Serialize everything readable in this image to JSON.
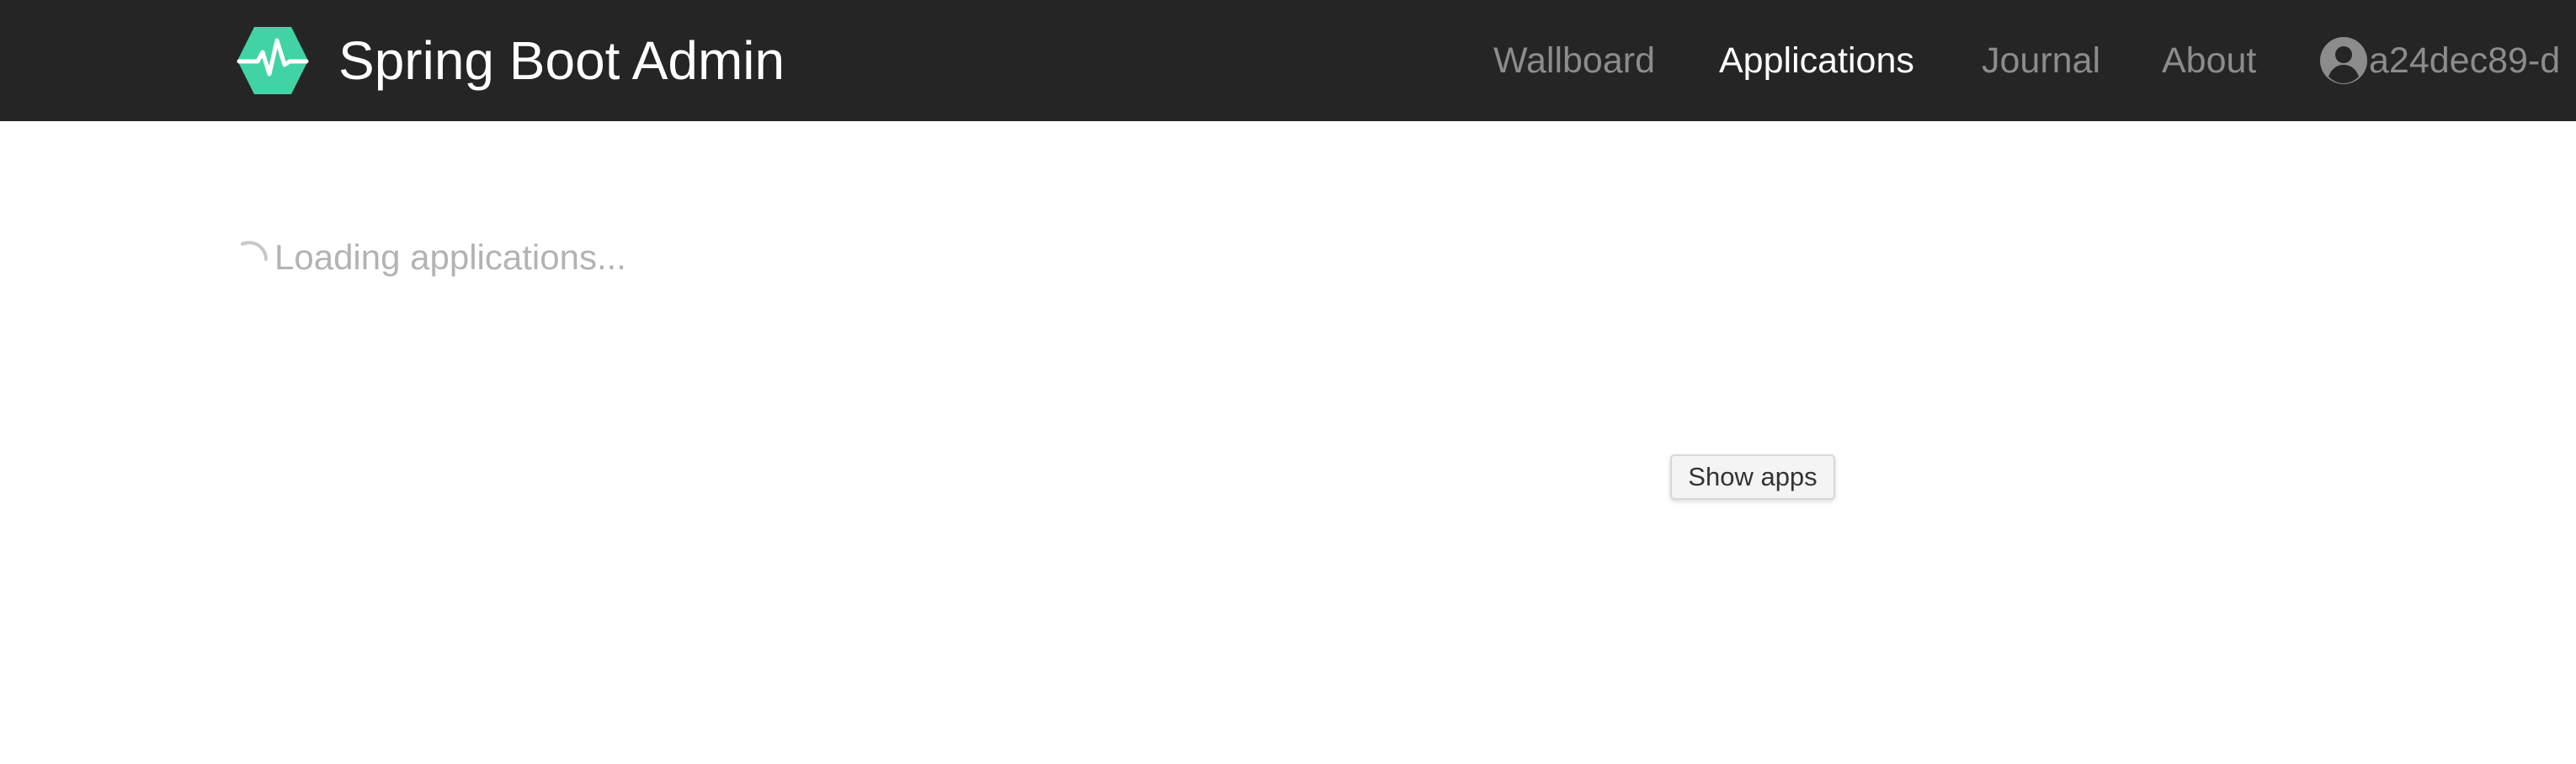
{
  "navbar": {
    "brand": {
      "title": "Spring Boot Admin",
      "logo_icon": "pulse-hexagon-icon",
      "logo_color": "#42d3a5"
    },
    "items": [
      {
        "label": "Wallboard",
        "active": false
      },
      {
        "label": "Applications",
        "active": true
      },
      {
        "label": "Journal",
        "active": false
      },
      {
        "label": "About",
        "active": false
      }
    ],
    "user": {
      "icon": "user-circle-icon",
      "name": "a24dec89-d"
    },
    "background_color": "#252525",
    "active_color": "#ffffff",
    "inactive_color": "#8c8c8c"
  },
  "main": {
    "loading": {
      "icon": "spinner-icon",
      "text": "Loading applications..."
    },
    "show_apps_button": {
      "label": "Show apps"
    }
  }
}
